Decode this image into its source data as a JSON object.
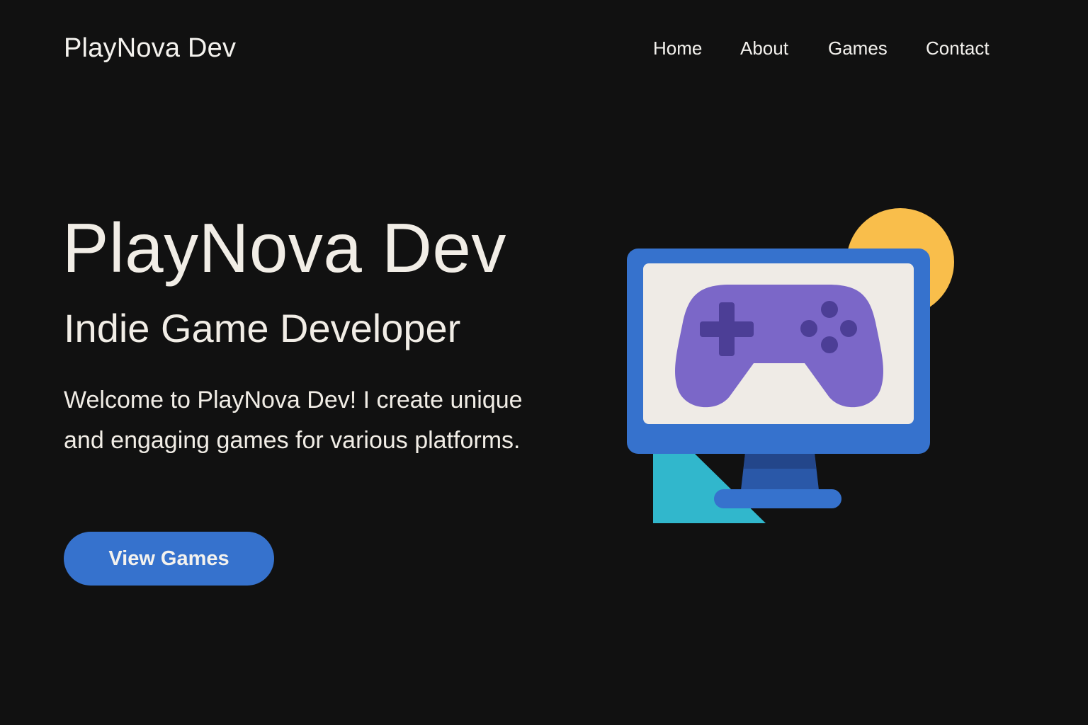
{
  "header": {
    "brand": "PlayNova Dev",
    "nav": [
      "Home",
      "About",
      "Games",
      "Contact"
    ]
  },
  "hero": {
    "title": "PlayNova Dev",
    "subtitle": "Indie Game Developer",
    "description": "Welcome to PlayNova Dev! I create unique and engaging games for various platforms.",
    "cta_label": "View Games"
  },
  "illustration": {
    "icons": [
      "monitor-icon",
      "gamepad-icon",
      "sun-circle-icon",
      "triangle-shape"
    ]
  },
  "colors": {
    "background": "#111111",
    "text": "#f1ede6",
    "accent_blue": "#3672cd",
    "gamepad_purple": "#7b67c8",
    "gamepad_dark": "#4c3e96",
    "sun_yellow": "#f9be4b",
    "teal": "#31b7cc",
    "screen": "#efebe6"
  }
}
